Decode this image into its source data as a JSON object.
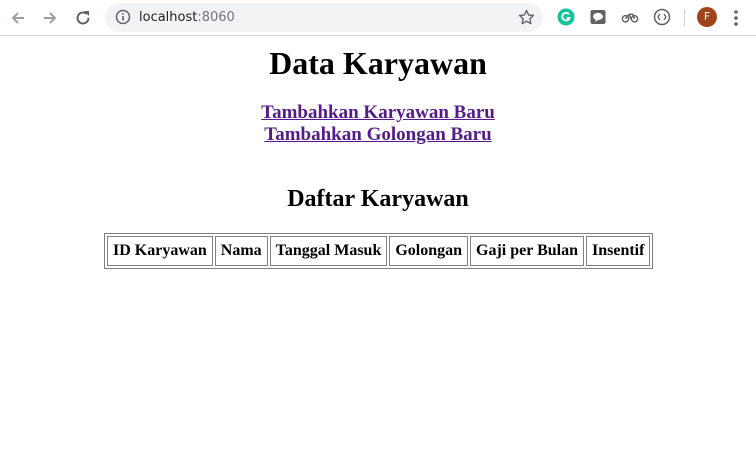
{
  "browser": {
    "url_host": "localhost",
    "url_port": ":8060",
    "avatar_letter": "F",
    "icons": {
      "back": "back-arrow-icon",
      "forward": "forward-arrow-icon",
      "reload": "reload-icon",
      "info": "info-icon",
      "star": "star-icon",
      "grammarly": "grammarly-icon",
      "ext_chat": "chat-extension-icon",
      "ext_bike": "bike-extension-icon",
      "ext_code": "code-extension-icon",
      "menu": "menu-dots-icon"
    },
    "colors": {
      "grammarly": "#15c39a",
      "avatar": "#a0441b",
      "link": "#551a8b"
    }
  },
  "page": {
    "title": "Data Karyawan",
    "links": [
      {
        "label": "Tambahkan Karyawan Baru"
      },
      {
        "label": "Tambahkan Golongan Baru"
      }
    ],
    "section_title": "Daftar Karyawan",
    "table": {
      "headers": [
        "ID Karyawan",
        "Nama",
        "Tanggal Masuk",
        "Golongan",
        "Gaji per Bulan",
        "Insentif"
      ],
      "rows": []
    }
  }
}
